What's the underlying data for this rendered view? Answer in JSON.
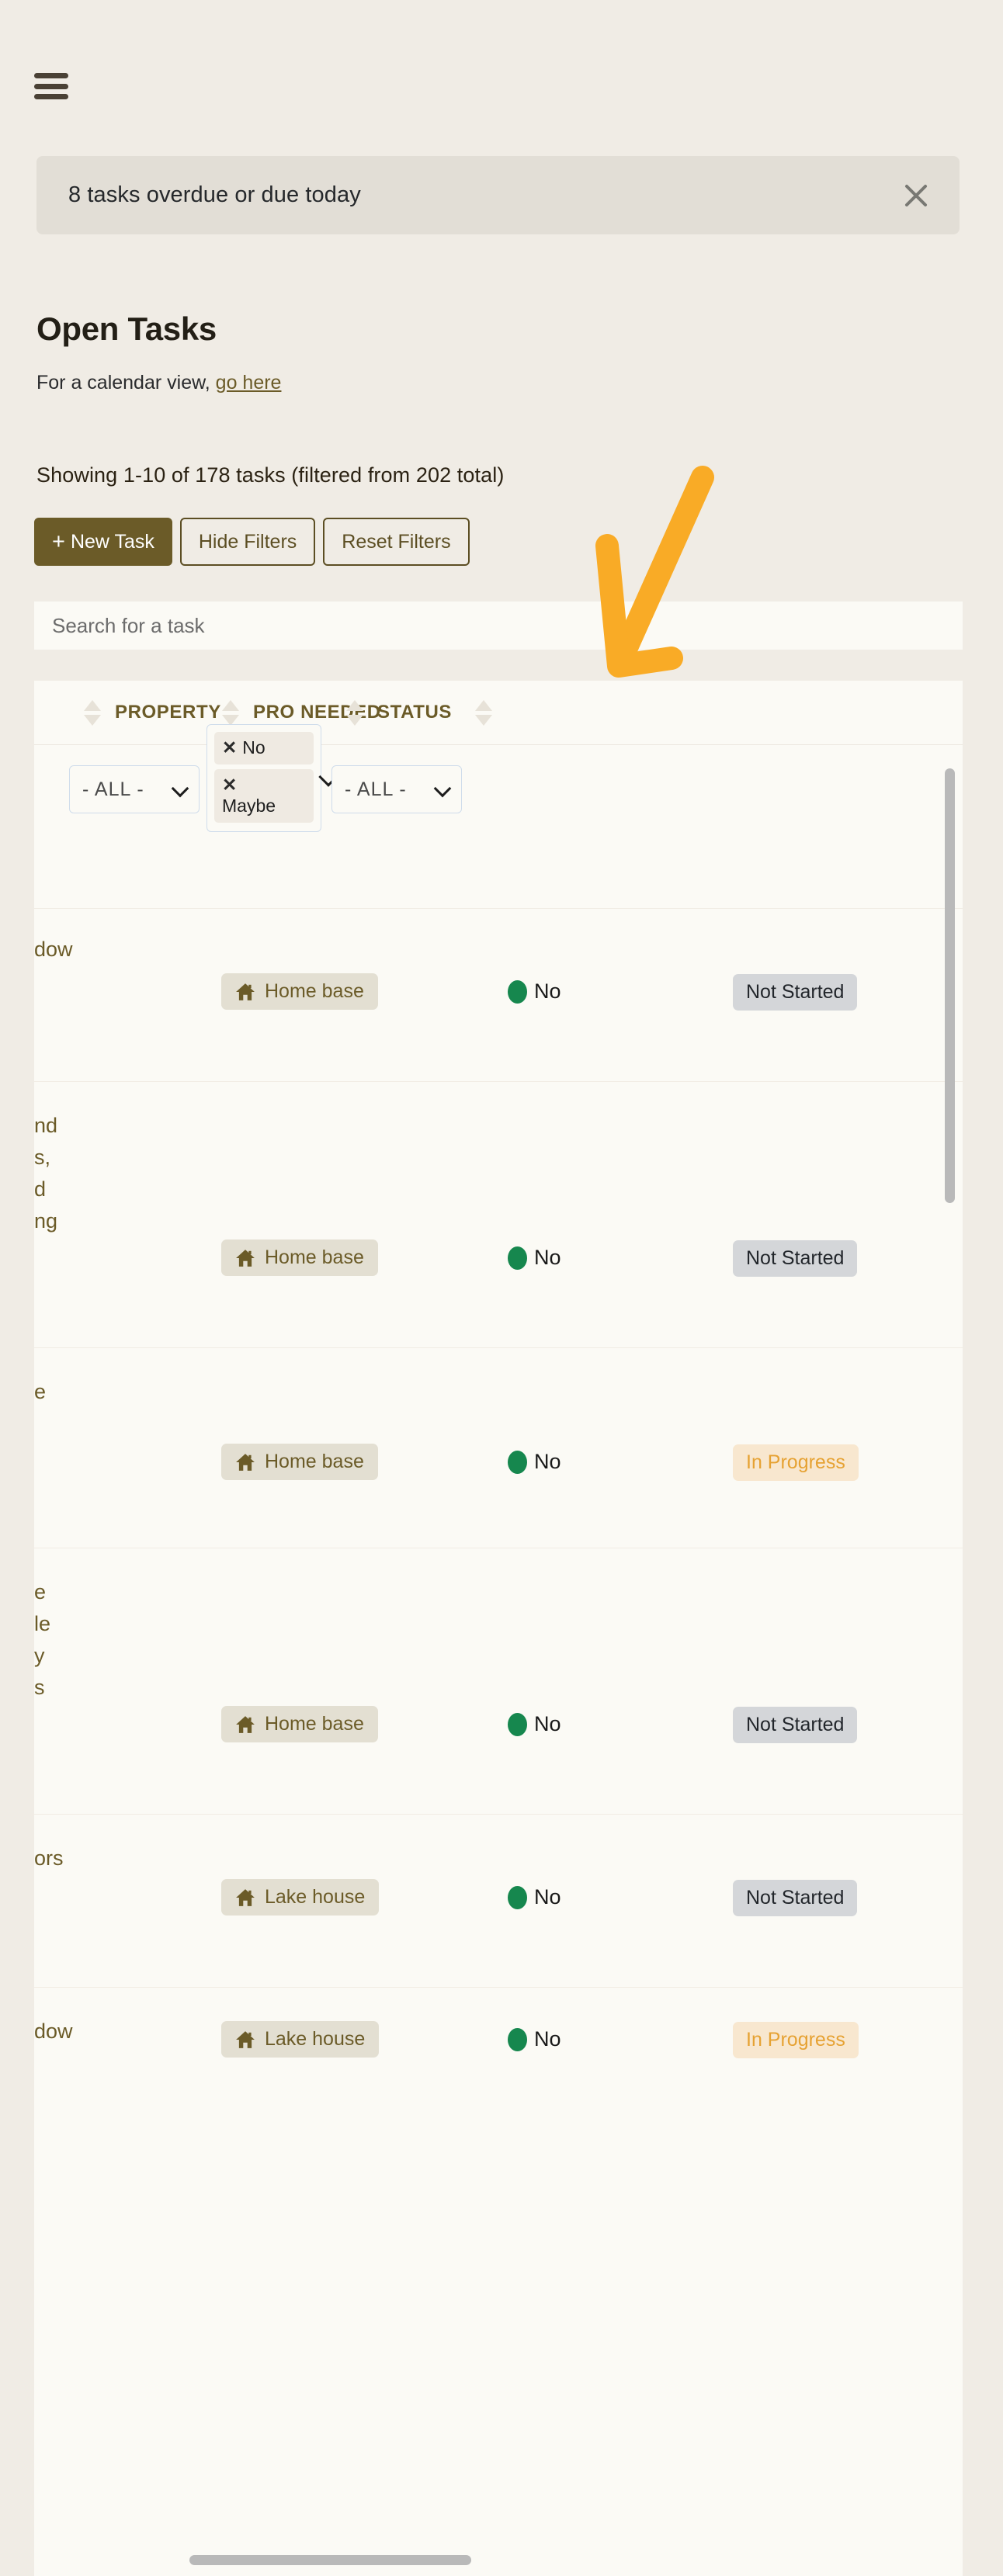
{
  "app": {
    "menu_icon": "hamburger-menu-icon"
  },
  "banner": {
    "text": "8 tasks overdue or due today",
    "close_icon": "close-icon",
    "background": "#e2ded6"
  },
  "header": {
    "title": "Open Tasks",
    "subtitle_prefix": "For a calendar view, ",
    "subtitle_link": "go here",
    "showing": "Showing 1-10 of 178 tasks (filtered from 202 total)"
  },
  "toolbar": {
    "new_task_label": "New Task",
    "new_task_plus": "+",
    "hide_filters_label": "Hide Filters",
    "reset_filters_label": "Reset Filters",
    "primary_color": "#6b5b28"
  },
  "search": {
    "placeholder": "Search for a task",
    "value": ""
  },
  "table": {
    "columns": [
      {
        "label": "PROPERTY",
        "sort_icon": "sort-arrows-icon"
      },
      {
        "label": "PRO NEEDED",
        "sort_icon": "sort-arrows-icon"
      },
      {
        "label": "STATUS",
        "sort_icon": "sort-arrows-icon"
      }
    ],
    "filters": {
      "property": {
        "value": "- ALL -",
        "chevron": "chevron-down-icon"
      },
      "pro_needed": {
        "chips": [
          {
            "remove_icon": "✕",
            "label": "No"
          },
          {
            "remove_icon": "✕",
            "label": "Maybe"
          }
        ],
        "chevron": "chevron-down-icon"
      },
      "status": {
        "value": "- ALL -",
        "chevron": "chevron-down-icon"
      }
    },
    "rows": [
      {
        "task": "dow",
        "property": "Home base",
        "property_icon": "home-icon",
        "pro_needed": "No",
        "pro_dot_color": "#16874e",
        "status": "Not Started",
        "status_kind": "notstarted"
      },
      {
        "task": "nd\ns,\nd\nng",
        "property": "Home base",
        "property_icon": "home-icon",
        "pro_needed": "No",
        "pro_dot_color": "#16874e",
        "status": "Not Started",
        "status_kind": "notstarted"
      },
      {
        "task": "e",
        "property": "Home base",
        "property_icon": "home-icon",
        "pro_needed": "No",
        "pro_dot_color": "#16874e",
        "status": "In Progress",
        "status_kind": "inprogress"
      },
      {
        "task": "e\nle\ny\ns",
        "property": "Home base",
        "property_icon": "home-icon",
        "pro_needed": "No",
        "pro_dot_color": "#16874e",
        "status": "Not Started",
        "status_kind": "notstarted"
      },
      {
        "task": "ors",
        "property": "Lake house",
        "property_icon": "home-icon",
        "pro_needed": "No",
        "pro_dot_color": "#16874e",
        "status": "Not Started",
        "status_kind": "notstarted"
      },
      {
        "task": "dow",
        "property": "Lake house",
        "property_icon": "home-icon",
        "pro_needed": "No",
        "pro_dot_color": "#16874e",
        "status": "In Progress",
        "status_kind": "inprogress"
      }
    ],
    "vertical_scrollbar": "vertical-scrollbar",
    "horizontal_scrollbar": "horizontal-scrollbar"
  },
  "annotation": {
    "arrow_color": "#f9ab26",
    "points_to": "PRO NEEDED column filter"
  }
}
